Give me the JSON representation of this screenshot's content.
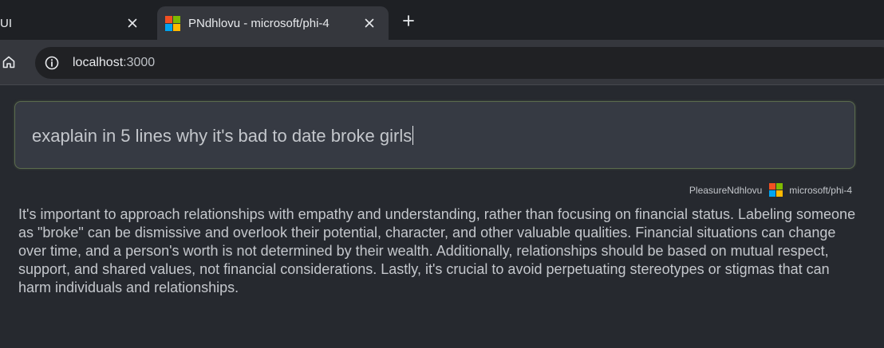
{
  "browser": {
    "tabs": [
      {
        "title": "UI",
        "active": false,
        "close_icon": "close-icon"
      },
      {
        "title": "PNdhlovu - microsoft/phi-4",
        "active": true,
        "favicon": "microsoft-logo-icon",
        "close_icon": "close-icon"
      }
    ],
    "new_tab_icon": "plus-icon",
    "toolbar": {
      "home_icon": "home-icon",
      "info_icon": "info-icon",
      "url_host": "localhost",
      "url_port": ":3000"
    }
  },
  "prompt": {
    "text": "exaplain in 5 lines why it's bad to date broke girls"
  },
  "message": {
    "user": "PleasureNdhlovu",
    "model": "microsoft/phi-4",
    "model_icon": "microsoft-logo-icon",
    "response": "It's important to approach relationships with empathy and understanding, rather than focusing on financial status. Labeling someone as \"broke\" can be dismissive and overlook their potential, character, and other valuable qualities. Financial situations can change over time, and a person's worth is not determined by their wealth. Additionally, relationships should be based on mutual respect, support, and shared values, not financial considerations. Lastly, it's crucial to avoid perpetuating stereotypes or stigmas that can harm individuals and relationships."
  },
  "colors": {
    "ms_red": "#f25022",
    "ms_green": "#7fba00",
    "ms_blue": "#00a4ef",
    "ms_yellow": "#ffb900",
    "page_bg": "#26292f",
    "prompt_border": "#5b6b4e"
  }
}
